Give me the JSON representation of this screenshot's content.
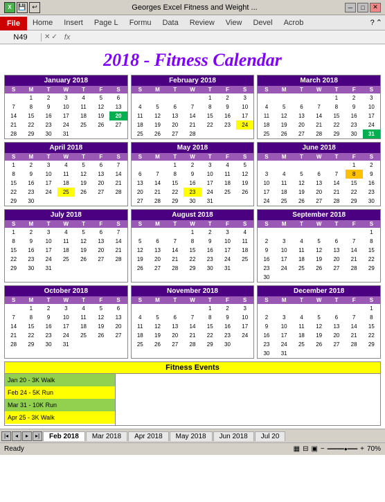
{
  "titlebar": {
    "title": "Georges Excel Fitness and Weight ...",
    "icon": "X",
    "tabs": [
      "File",
      "Home",
      "Insert",
      "Page L",
      "Formu",
      "Data",
      "Review",
      "View",
      "Devel",
      "Acrob"
    ],
    "active_tab": "File",
    "cell_ref": "N49",
    "fx": "fx"
  },
  "calendar": {
    "main_title": "2018 - Fitness Calendar",
    "months": [
      {
        "name": "January 2018",
        "days": [
          "S",
          "M",
          "T",
          "W",
          "T",
          "F",
          "S"
        ],
        "rows": [
          [
            "",
            "1",
            "2",
            "3",
            "4",
            "5",
            "6"
          ],
          [
            "7",
            "8",
            "9",
            "10",
            "11",
            "12",
            "13"
          ],
          [
            "14",
            "15",
            "16",
            "17",
            "18",
            "19",
            "20"
          ],
          [
            "21",
            "22",
            "23",
            "24",
            "25",
            "26",
            "27"
          ],
          [
            "28",
            "29",
            "30",
            "31",
            "",
            "",
            ""
          ]
        ],
        "highlights": {
          "20": "green"
        }
      },
      {
        "name": "February 2018",
        "days": [
          "S",
          "M",
          "T",
          "W",
          "T",
          "F",
          "S"
        ],
        "rows": [
          [
            "",
            "",
            "",
            "",
            "1",
            "2",
            "3"
          ],
          [
            "4",
            "5",
            "6",
            "7",
            "8",
            "9",
            "10"
          ],
          [
            "11",
            "12",
            "13",
            "14",
            "15",
            "16",
            "17"
          ],
          [
            "18",
            "19",
            "20",
            "21",
            "22",
            "23",
            "24"
          ],
          [
            "25",
            "26",
            "27",
            "28",
            "",
            "",
            ""
          ]
        ],
        "highlights": {
          "24": "yellow"
        }
      },
      {
        "name": "March 2018",
        "days": [
          "S",
          "M",
          "T",
          "W",
          "T",
          "F",
          "S"
        ],
        "rows": [
          [
            "",
            "",
            "",
            "",
            "1",
            "2",
            "3"
          ],
          [
            "4",
            "5",
            "6",
            "7",
            "8",
            "9",
            "10"
          ],
          [
            "11",
            "12",
            "13",
            "14",
            "15",
            "16",
            "17"
          ],
          [
            "18",
            "19",
            "20",
            "21",
            "22",
            "23",
            "24"
          ],
          [
            "25",
            "26",
            "27",
            "28",
            "29",
            "30",
            "31"
          ]
        ],
        "highlights": {
          "31": "green"
        }
      },
      {
        "name": "April 2018",
        "days": [
          "S",
          "M",
          "T",
          "W",
          "T",
          "F",
          "S"
        ],
        "rows": [
          [
            "1",
            "2",
            "3",
            "4",
            "5",
            "6",
            "7"
          ],
          [
            "8",
            "9",
            "10",
            "11",
            "12",
            "13",
            "14"
          ],
          [
            "15",
            "16",
            "17",
            "18",
            "19",
            "20",
            "21"
          ],
          [
            "22",
            "23",
            "24",
            "25",
            "26",
            "27",
            "28"
          ],
          [
            "29",
            "30",
            "",
            "",
            "",
            "",
            ""
          ]
        ],
        "highlights": {
          "25": "yellow"
        }
      },
      {
        "name": "May 2018",
        "days": [
          "S",
          "M",
          "T",
          "W",
          "T",
          "F",
          "S"
        ],
        "rows": [
          [
            "",
            "",
            "1",
            "2",
            "3",
            "4",
            "5"
          ],
          [
            "6",
            "7",
            "8",
            "9",
            "10",
            "11",
            "12"
          ],
          [
            "13",
            "14",
            "15",
            "16",
            "17",
            "18",
            "19"
          ],
          [
            "20",
            "21",
            "22",
            "23",
            "24",
            "25",
            "26"
          ],
          [
            "27",
            "28",
            "29",
            "30",
            "31",
            "",
            ""
          ]
        ],
        "highlights": {
          "23": "yellow"
        }
      },
      {
        "name": "June 2018",
        "days": [
          "S",
          "M",
          "T",
          "W",
          "T",
          "F",
          "S"
        ],
        "rows": [
          [
            "",
            "",
            "",
            "",
            "",
            "1",
            "2"
          ],
          [
            "3",
            "4",
            "5",
            "6",
            "7",
            "8",
            "9"
          ],
          [
            "10",
            "11",
            "12",
            "13",
            "14",
            "15",
            "16"
          ],
          [
            "17",
            "18",
            "19",
            "20",
            "21",
            "22",
            "23"
          ],
          [
            "24",
            "25",
            "26",
            "27",
            "28",
            "29",
            "30"
          ]
        ],
        "highlights": {
          "8": "orange"
        }
      },
      {
        "name": "July 2018",
        "days": [
          "S",
          "M",
          "T",
          "W",
          "T",
          "F",
          "S"
        ],
        "rows": [
          [
            "1",
            "2",
            "3",
            "4",
            "5",
            "6",
            "7"
          ],
          [
            "8",
            "9",
            "10",
            "11",
            "12",
            "13",
            "14"
          ],
          [
            "15",
            "16",
            "17",
            "18",
            "19",
            "20",
            "21"
          ],
          [
            "22",
            "23",
            "24",
            "25",
            "26",
            "27",
            "28"
          ],
          [
            "29",
            "30",
            "31",
            "",
            "",
            "",
            ""
          ]
        ],
        "highlights": {}
      },
      {
        "name": "August 2018",
        "days": [
          "S",
          "M",
          "T",
          "W",
          "T",
          "F",
          "S"
        ],
        "rows": [
          [
            "",
            "",
            "",
            "1",
            "2",
            "3",
            "4"
          ],
          [
            "5",
            "6",
            "7",
            "8",
            "9",
            "10",
            "11"
          ],
          [
            "12",
            "13",
            "14",
            "15",
            "16",
            "17",
            "18"
          ],
          [
            "19",
            "20",
            "21",
            "22",
            "23",
            "24",
            "25"
          ],
          [
            "26",
            "27",
            "28",
            "29",
            "30",
            "31",
            ""
          ]
        ],
        "highlights": {}
      },
      {
        "name": "September 2018",
        "days": [
          "S",
          "M",
          "T",
          "W",
          "T",
          "F",
          "S"
        ],
        "rows": [
          [
            "",
            "",
            "",
            "",
            "",
            "",
            "1"
          ],
          [
            "2",
            "3",
            "4",
            "5",
            "6",
            "7",
            "8"
          ],
          [
            "9",
            "10",
            "11",
            "12",
            "13",
            "14",
            "15"
          ],
          [
            "16",
            "17",
            "18",
            "19",
            "20",
            "21",
            "22"
          ],
          [
            "23",
            "24",
            "25",
            "26",
            "27",
            "28",
            "29"
          ],
          [
            "30",
            "",
            "",
            "",
            "",
            "",
            ""
          ]
        ],
        "highlights": {}
      },
      {
        "name": "October 2018",
        "days": [
          "S",
          "M",
          "T",
          "W",
          "T",
          "F",
          "S"
        ],
        "rows": [
          [
            "",
            "1",
            "2",
            "3",
            "4",
            "5",
            "6"
          ],
          [
            "7",
            "8",
            "9",
            "10",
            "11",
            "12",
            "13"
          ],
          [
            "14",
            "15",
            "16",
            "17",
            "18",
            "19",
            "20"
          ],
          [
            "21",
            "22",
            "23",
            "24",
            "25",
            "26",
            "27"
          ],
          [
            "28",
            "29",
            "30",
            "31",
            "",
            "",
            ""
          ]
        ],
        "highlights": {}
      },
      {
        "name": "November 2018",
        "days": [
          "S",
          "M",
          "T",
          "W",
          "T",
          "F",
          "S"
        ],
        "rows": [
          [
            "",
            "",
            "",
            "",
            "1",
            "2",
            "3"
          ],
          [
            "4",
            "5",
            "6",
            "7",
            "8",
            "9",
            "10"
          ],
          [
            "11",
            "12",
            "13",
            "14",
            "15",
            "16",
            "17"
          ],
          [
            "18",
            "19",
            "20",
            "21",
            "22",
            "23",
            "24"
          ],
          [
            "25",
            "26",
            "27",
            "28",
            "29",
            "30",
            ""
          ]
        ],
        "highlights": {}
      },
      {
        "name": "December 2018",
        "days": [
          "S",
          "M",
          "T",
          "W",
          "T",
          "F",
          "S"
        ],
        "rows": [
          [
            "",
            "",
            "",
            "",
            "",
            "",
            "1"
          ],
          [
            "2",
            "3",
            "4",
            "5",
            "6",
            "7",
            "8"
          ],
          [
            "9",
            "10",
            "11",
            "12",
            "13",
            "14",
            "15"
          ],
          [
            "16",
            "17",
            "18",
            "19",
            "20",
            "21",
            "22"
          ],
          [
            "23",
            "24",
            "25",
            "26",
            "27",
            "28",
            "29"
          ],
          [
            "30",
            "31",
            "",
            "",
            "",
            "",
            ""
          ]
        ],
        "highlights": {}
      }
    ]
  },
  "events": {
    "header": "Fitness Events",
    "items": [
      {
        "label": "Jan 20 - 3K Walk",
        "color": "green"
      },
      {
        "label": "Feb 24 - 5K Run",
        "color": "yellow"
      },
      {
        "label": "Mar 31 - 10K Run",
        "color": "green"
      },
      {
        "label": "Apr 25 - 3K Walk",
        "color": "yellow"
      }
    ]
  },
  "sheet_tabs": {
    "tabs": [
      "Feb 2018",
      "Mar 2018",
      "Apr 2018",
      "May 2018",
      "Jun 2018",
      "Jul 20"
    ]
  },
  "statusbar": {
    "status": "Ready",
    "zoom": "70%"
  }
}
